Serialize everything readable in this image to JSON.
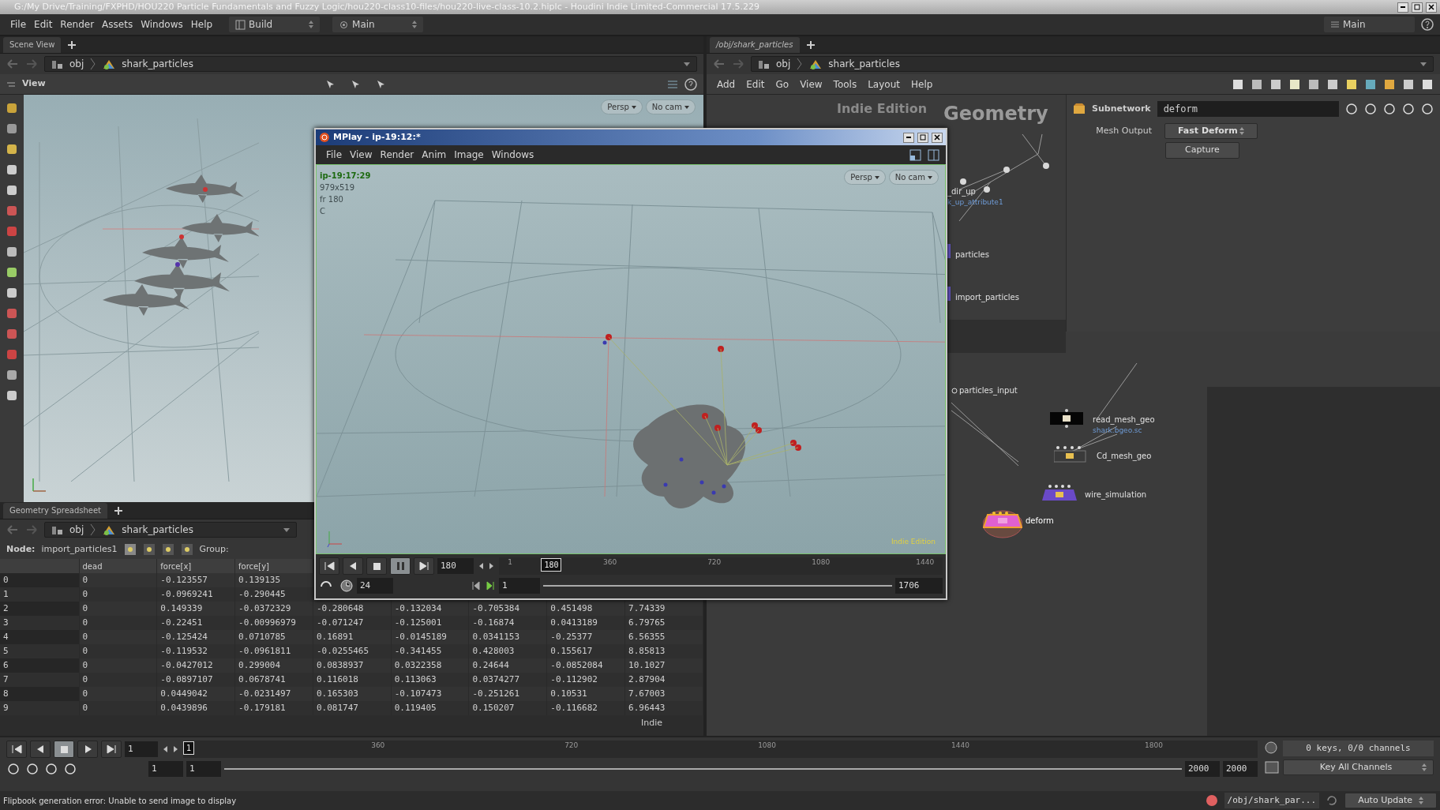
{
  "window": {
    "title": "G:/My Drive/Training/FXPHD/HOU220 Particle Fundamentals and Fuzzy Logic/hou220-class10-files/hou220-live-class-10.2.hiplc - Houdini Indie Limited-Commercial 17.5.229"
  },
  "menu": [
    "File",
    "Edit",
    "Render",
    "Assets",
    "Windows",
    "Help"
  ],
  "desktops": [
    {
      "label": "Build"
    },
    {
      "label": "Main"
    }
  ],
  "desktop_right": "Main",
  "scene_view": {
    "tab": "Scene View",
    "path": [
      "obj",
      "shark_particles"
    ],
    "toolbar_title": "View",
    "camera_menus": [
      "Persp",
      "No cam"
    ]
  },
  "spreadsheet": {
    "tab": "Geometry Spreadsheet",
    "path": [
      "obj",
      "shark_particles"
    ],
    "node_label": "Node:",
    "node": "import_particles1",
    "group_label": "Group:",
    "columns": [
      "dead",
      "force[x]",
      "force[y]"
    ],
    "rows": [
      {
        "index": "0",
        "cells": [
          "0",
          "-0.123557",
          "0.139135"
        ]
      },
      {
        "index": "1",
        "cells": [
          "0",
          "-0.0969241",
          "-0.290445"
        ]
      },
      {
        "index": "2",
        "cells": [
          "0",
          "0.149339",
          "-0.0372329",
          "-0.280648",
          "-0.132034",
          "-0.705384",
          "0.451498",
          "7.74339"
        ]
      },
      {
        "index": "3",
        "cells": [
          "0",
          "-0.22451",
          "-0.00996979",
          "-0.071247",
          "-0.125001",
          "-0.16874",
          "0.0413189",
          "6.79765"
        ]
      },
      {
        "index": "4",
        "cells": [
          "0",
          "-0.125424",
          "0.0710785",
          "0.16891",
          "-0.0145189",
          "0.0341153",
          "-0.25377",
          "6.56355"
        ]
      },
      {
        "index": "5",
        "cells": [
          "0",
          "-0.119532",
          "-0.0961811",
          "-0.0255465",
          "-0.341455",
          "0.428003",
          "0.155617",
          "8.85813"
        ]
      },
      {
        "index": "6",
        "cells": [
          "0",
          "-0.0427012",
          "0.299004",
          "0.0838937",
          "0.0322358",
          "0.24644",
          "-0.0852084",
          "10.1027"
        ]
      },
      {
        "index": "7",
        "cells": [
          "0",
          "-0.0897107",
          "0.0678741",
          "0.116018",
          "0.113063",
          "0.0374277",
          "-0.112902",
          "2.87904"
        ]
      },
      {
        "index": "8",
        "cells": [
          "0",
          "0.0449042",
          "-0.0231497",
          "0.165303",
          "-0.107473",
          "-0.251261",
          "0.10531",
          "7.67003"
        ]
      },
      {
        "index": "9",
        "cells": [
          "0",
          "0.0439896",
          "-0.179181",
          "0.081747",
          "0.119405",
          "0.150207",
          "-0.116682",
          "6.96443"
        ]
      }
    ],
    "footer": "Indie"
  },
  "mplay": {
    "title": "MPlay - ip-19:12:*",
    "menu": [
      "File",
      "View",
      "Render",
      "Anim",
      "Image",
      "Windows"
    ],
    "info": [
      "ip-19:17:29",
      "979x519",
      "fr 180",
      "C"
    ],
    "camera_menus": [
      "Persp",
      "No cam"
    ],
    "edition_label": "Indie Edition",
    "transport": [
      {
        "kind": "first",
        "selected": false
      },
      {
        "kind": "back",
        "selected": false
      },
      {
        "kind": "stop",
        "selected": false
      },
      {
        "kind": "pause",
        "selected": true
      },
      {
        "kind": "last",
        "selected": false
      }
    ],
    "frame": "180",
    "marker": "180",
    "ruler_ticks": [
      "1",
      "360",
      "720",
      "1080",
      "1440"
    ],
    "fps": "24",
    "start": "1",
    "end": "1706",
    "range_slider": {
      "level": 1
    }
  },
  "network": {
    "tab": "/obj/shark_particles",
    "path": [
      "obj",
      "shark_particles"
    ],
    "menu": [
      "Add",
      "Edit",
      "Go",
      "View",
      "Tools",
      "Layout",
      "Help"
    ],
    "context_label": "Geometry",
    "edition_label": "Indie Edition",
    "nodes": [
      {
        "name": "_dir_up",
        "subtitle": "k_up_attribute1",
        "kind": "label",
        "selected": false
      },
      {
        "name": "particles",
        "kind": "object",
        "selected": false
      },
      {
        "name": "import_particles",
        "kind": "object",
        "selected": false
      },
      {
        "name": "particles_input",
        "kind": "null",
        "selected": false
      },
      {
        "name": "read_mesh_geo",
        "subtitle": "shark.bgeo.sc",
        "kind": "file",
        "selected": false
      },
      {
        "name": "Cd_mesh_geo",
        "kind": "subnet",
        "selected": false
      },
      {
        "name": "wire_simulation",
        "kind": "sim",
        "selected": false
      },
      {
        "name": "deform",
        "kind": "deform",
        "selected": true
      }
    ]
  },
  "parameters": {
    "type": "Subnetwork",
    "name": "deform",
    "fields": [
      {
        "label": "Mesh Output",
        "value": "Fast Deform"
      }
    ],
    "button": "Capture"
  },
  "timeline": {
    "transport": [
      {
        "kind": "first",
        "selected": false
      },
      {
        "kind": "back",
        "selected": false
      },
      {
        "kind": "stop",
        "selected": true
      },
      {
        "kind": "play",
        "selected": false
      },
      {
        "kind": "last",
        "selected": false
      }
    ],
    "frame": "1",
    "marker": "1",
    "range_slider": {
      "level": 1
    },
    "ticks": [
      "360",
      "720",
      "1080",
      "1440",
      "1800"
    ],
    "range": [
      "1",
      "1",
      "2000",
      "2000"
    ],
    "keys": "0 keys, 0/0 channels",
    "key_button": "Key All Channels"
  },
  "status_bar": {
    "message": "Flipbook generation error: Unable to send image to display",
    "path": "/obj/shark_par...",
    "update_mode": "Auto Update"
  }
}
